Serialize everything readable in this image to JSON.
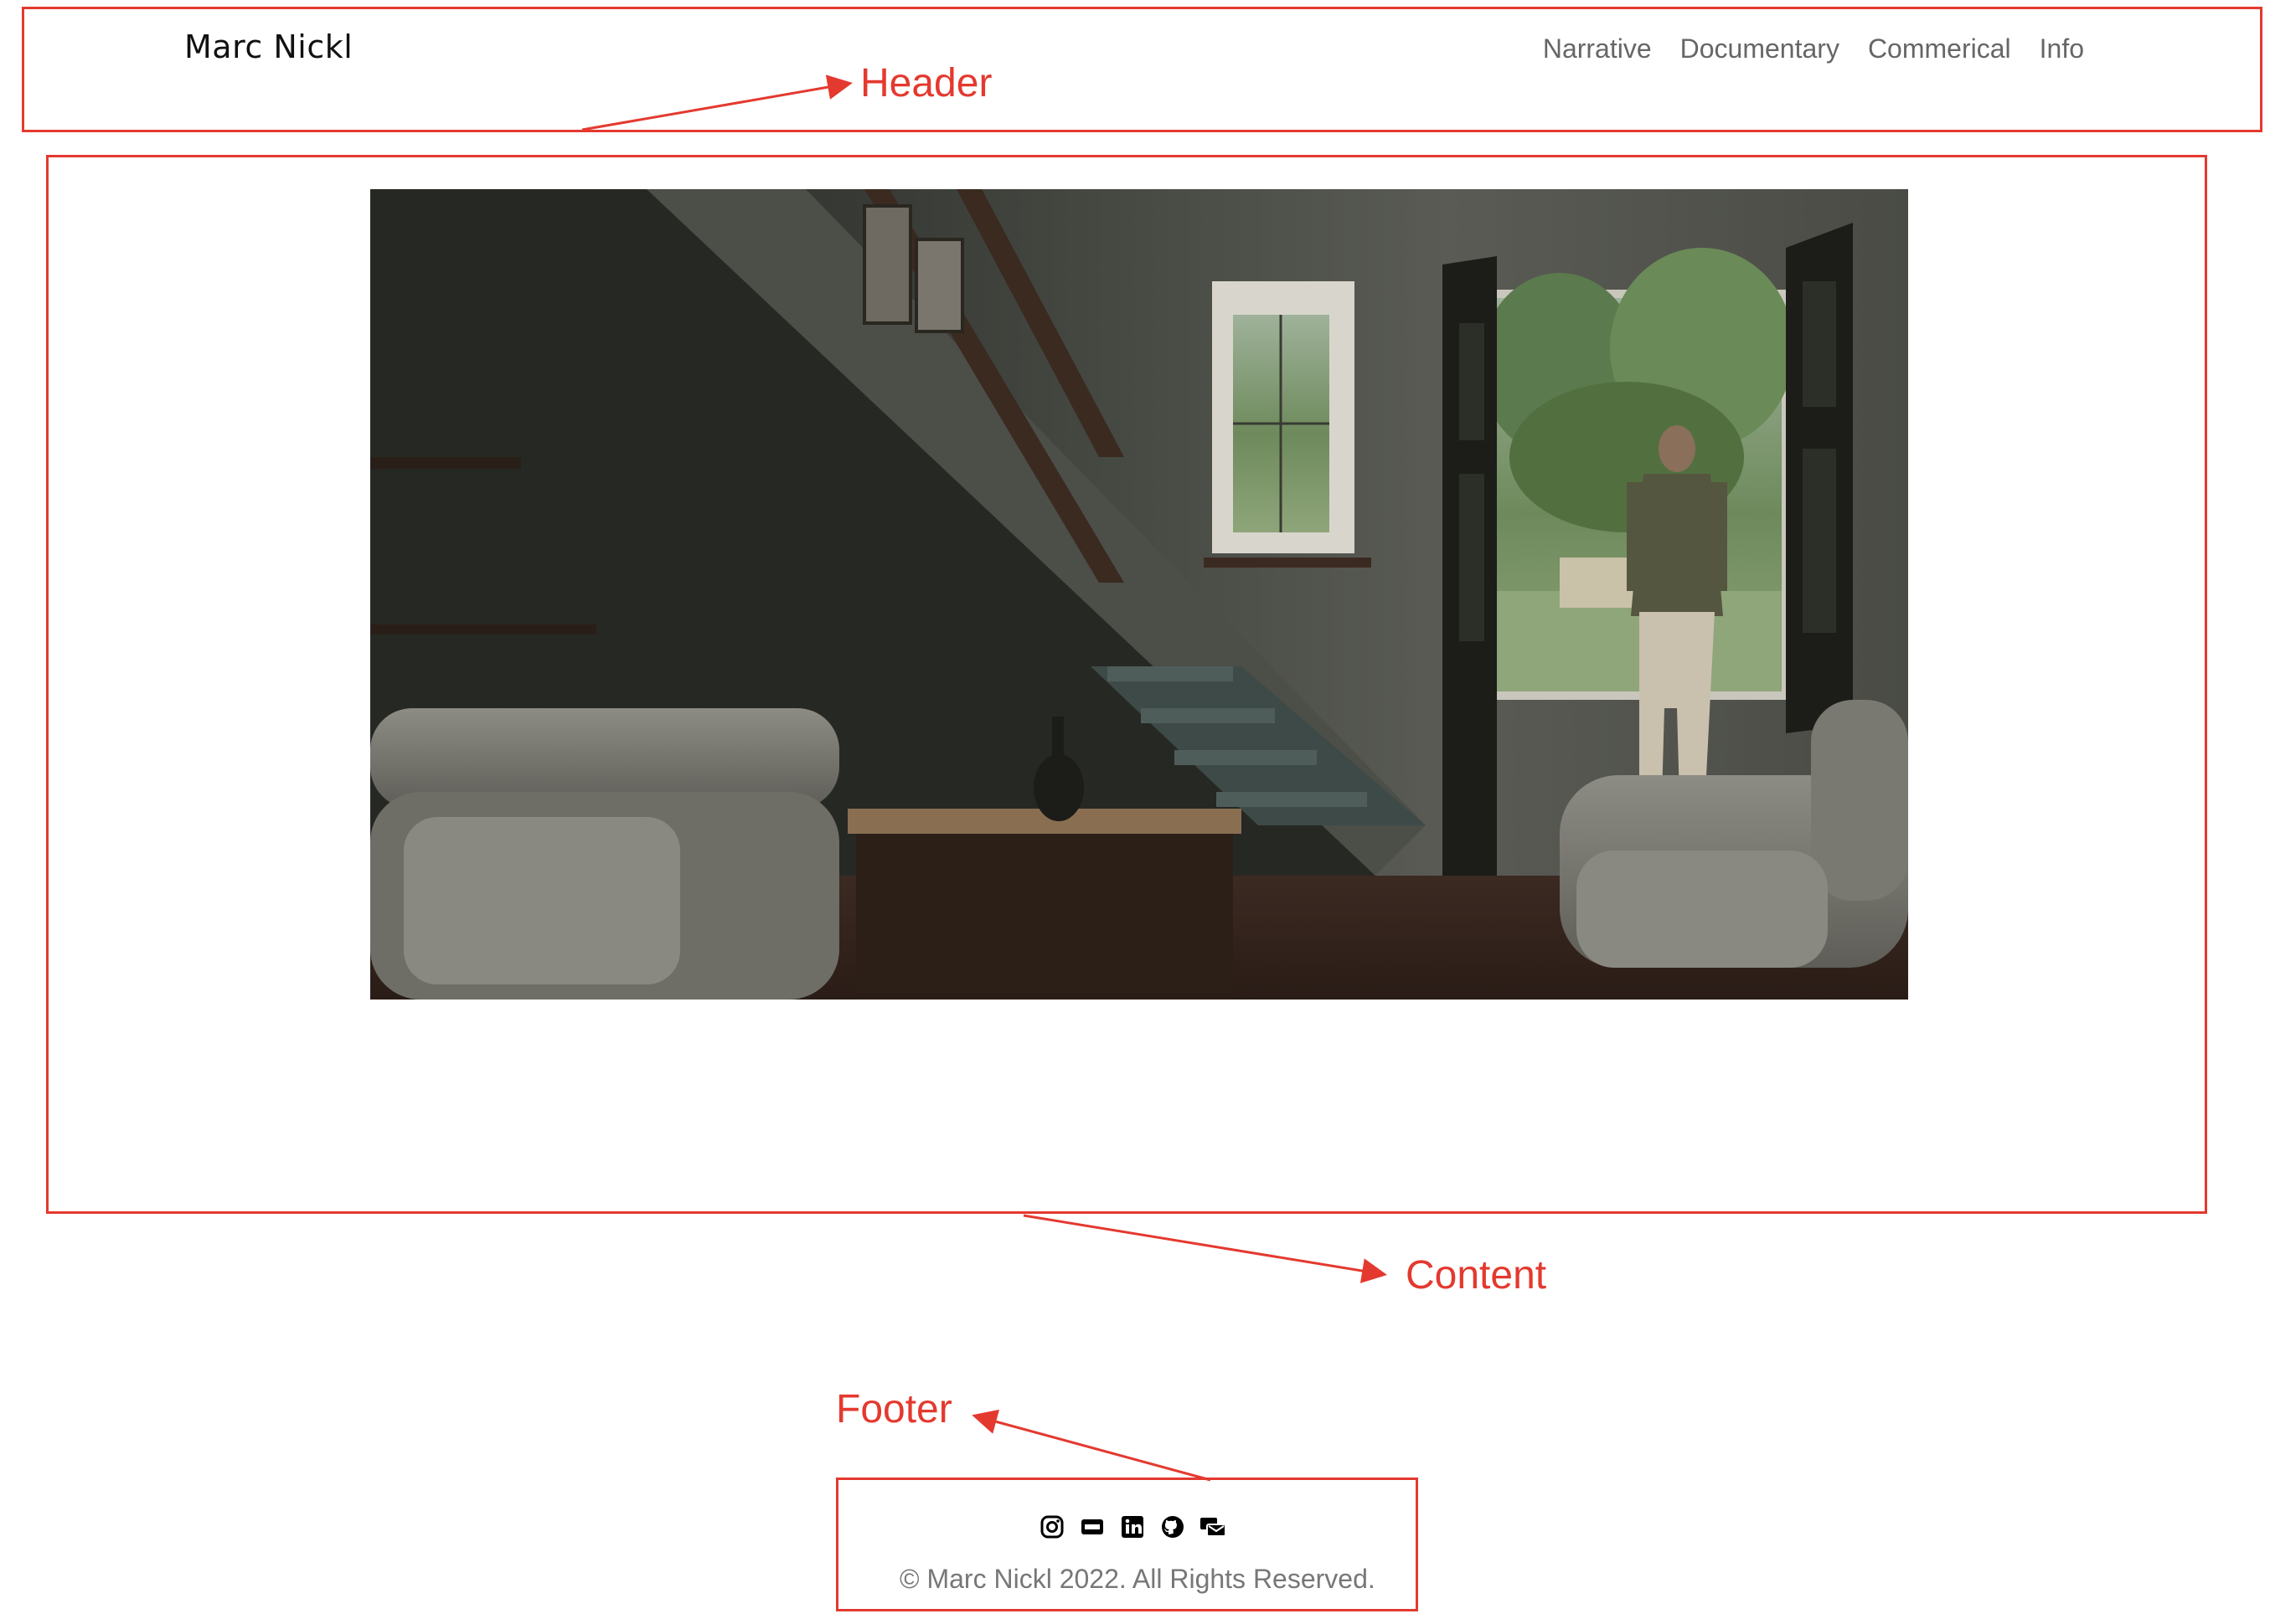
{
  "header": {
    "site_title": "Marc Nickl",
    "nav": [
      {
        "label": "Narrative"
      },
      {
        "label": "Documentary"
      },
      {
        "label": "Commerical"
      },
      {
        "label": "Info"
      }
    ]
  },
  "hero": {
    "alt": "Still frame: man standing in an open doorway of a dim living room with a staircase"
  },
  "footer": {
    "social_icons": [
      "instagram-icon",
      "imdb-icon",
      "linkedin-icon",
      "github-icon",
      "contact-icon"
    ],
    "copyright": "© Marc Nickl 2022. All Rights Reserved."
  },
  "annotations": {
    "header_label": "Header",
    "content_label": "Content",
    "footer_label": "Footer",
    "color": "#e4392f"
  }
}
